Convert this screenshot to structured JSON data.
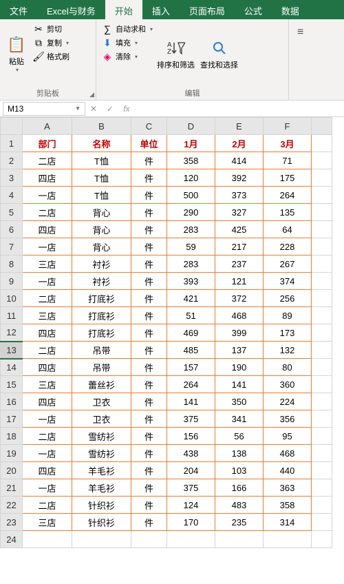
{
  "menu": {
    "items": [
      "文件",
      "Excel与财务",
      "开始",
      "插入",
      "页面布局",
      "公式",
      "数据"
    ],
    "active": 2
  },
  "ribbon": {
    "clipboard": {
      "label": "剪贴板",
      "paste": "粘贴",
      "cut": "剪切",
      "copy": "复制",
      "format_painter": "格式刷"
    },
    "editing": {
      "label": "编辑",
      "autosum": "自动求和",
      "fill": "填充",
      "clear": "清除",
      "sort_filter": "排序和筛选",
      "find_select": "查找和选择"
    }
  },
  "formula_bar": {
    "name_box": "M13",
    "cancel": "✕",
    "confirm": "✓",
    "fx": "fx",
    "value": ""
  },
  "columns": [
    "A",
    "B",
    "C",
    "D",
    "E",
    "F"
  ],
  "headers": [
    "部门",
    "名称",
    "单位",
    "1月",
    "2月",
    "3月"
  ],
  "rows": [
    [
      "二店",
      "T恤",
      "件",
      "358",
      "414",
      "71"
    ],
    [
      "四店",
      "T恤",
      "件",
      "120",
      "392",
      "175"
    ],
    [
      "一店",
      "T恤",
      "件",
      "500",
      "373",
      "264"
    ],
    [
      "二店",
      "背心",
      "件",
      "290",
      "327",
      "135"
    ],
    [
      "四店",
      "背心",
      "件",
      "283",
      "425",
      "64"
    ],
    [
      "一店",
      "背心",
      "件",
      "59",
      "217",
      "228"
    ],
    [
      "三店",
      "衬衫",
      "件",
      "283",
      "237",
      "267"
    ],
    [
      "一店",
      "衬衫",
      "件",
      "393",
      "121",
      "374"
    ],
    [
      "二店",
      "打底衫",
      "件",
      "421",
      "372",
      "256"
    ],
    [
      "三店",
      "打底衫",
      "件",
      "51",
      "468",
      "89"
    ],
    [
      "四店",
      "打底衫",
      "件",
      "469",
      "399",
      "173"
    ],
    [
      "二店",
      "吊带",
      "件",
      "485",
      "137",
      "132"
    ],
    [
      "四店",
      "吊带",
      "件",
      "157",
      "190",
      "80"
    ],
    [
      "三店",
      "蕾丝衫",
      "件",
      "264",
      "141",
      "360"
    ],
    [
      "四店",
      "卫衣",
      "件",
      "141",
      "350",
      "224"
    ],
    [
      "一店",
      "卫衣",
      "件",
      "375",
      "341",
      "356"
    ],
    [
      "二店",
      "雪纺衫",
      "件",
      "156",
      "56",
      "95"
    ],
    [
      "一店",
      "雪纺衫",
      "件",
      "438",
      "138",
      "468"
    ],
    [
      "四店",
      "羊毛衫",
      "件",
      "204",
      "103",
      "440"
    ],
    [
      "一店",
      "羊毛衫",
      "件",
      "375",
      "166",
      "363"
    ],
    [
      "二店",
      "针织衫",
      "件",
      "124",
      "483",
      "358"
    ],
    [
      "三店",
      "针织衫",
      "件",
      "170",
      "235",
      "314"
    ]
  ],
  "selected_row": 13,
  "chart_data": {
    "type": "table",
    "title": "",
    "columns": [
      "部门",
      "名称",
      "单位",
      "1月",
      "2月",
      "3月"
    ],
    "data": [
      [
        "二店",
        "T恤",
        "件",
        358,
        414,
        71
      ],
      [
        "四店",
        "T恤",
        "件",
        120,
        392,
        175
      ],
      [
        "一店",
        "T恤",
        "件",
        500,
        373,
        264
      ],
      [
        "二店",
        "背心",
        "件",
        290,
        327,
        135
      ],
      [
        "四店",
        "背心",
        "件",
        283,
        425,
        64
      ],
      [
        "一店",
        "背心",
        "件",
        59,
        217,
        228
      ],
      [
        "三店",
        "衬衫",
        "件",
        283,
        237,
        267
      ],
      [
        "一店",
        "衬衫",
        "件",
        393,
        121,
        374
      ],
      [
        "二店",
        "打底衫",
        "件",
        421,
        372,
        256
      ],
      [
        "三店",
        "打底衫",
        "件",
        51,
        468,
        89
      ],
      [
        "四店",
        "打底衫",
        "件",
        469,
        399,
        173
      ],
      [
        "二店",
        "吊带",
        "件",
        485,
        137,
        132
      ],
      [
        "四店",
        "吊带",
        "件",
        157,
        190,
        80
      ],
      [
        "三店",
        "蕾丝衫",
        "件",
        264,
        141,
        360
      ],
      [
        "四店",
        "卫衣",
        "件",
        141,
        350,
        224
      ],
      [
        "一店",
        "卫衣",
        "件",
        375,
        341,
        356
      ],
      [
        "二店",
        "雪纺衫",
        "件",
        156,
        56,
        95
      ],
      [
        "一店",
        "雪纺衫",
        "件",
        438,
        138,
        468
      ],
      [
        "四店",
        "羊毛衫",
        "件",
        204,
        103,
        440
      ],
      [
        "一店",
        "羊毛衫",
        "件",
        375,
        166,
        363
      ],
      [
        "二店",
        "针织衫",
        "件",
        124,
        483,
        358
      ],
      [
        "三店",
        "针织衫",
        "件",
        170,
        235,
        314
      ]
    ]
  }
}
